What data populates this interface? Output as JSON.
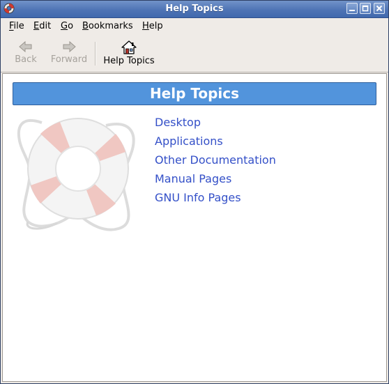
{
  "window": {
    "title": "Help Topics",
    "accent_color": "#4f74b5",
    "controls": [
      "minimize-icon",
      "maximize-icon",
      "close-icon"
    ]
  },
  "menubar": {
    "items": [
      {
        "label": "File",
        "mnemonic": "F"
      },
      {
        "label": "Edit",
        "mnemonic": "E"
      },
      {
        "label": "Go",
        "mnemonic": "G"
      },
      {
        "label": "Bookmarks",
        "mnemonic": "B"
      },
      {
        "label": "Help",
        "mnemonic": "H"
      }
    ]
  },
  "toolbar": {
    "back": {
      "label": "Back",
      "icon": "arrow-left-icon",
      "enabled": false
    },
    "forward": {
      "label": "Forward",
      "icon": "arrow-right-icon",
      "enabled": false
    },
    "home": {
      "label": "Help Topics",
      "icon": "home-icon",
      "enabled": true
    }
  },
  "content": {
    "heading": "Help Topics",
    "heading_color": "#5294dc",
    "illustration": "life-buoy-icon",
    "links": [
      "Desktop",
      "Applications",
      "Other Documentation",
      "Manual Pages",
      "GNU Info Pages"
    ],
    "link_color": "#3450c8"
  }
}
